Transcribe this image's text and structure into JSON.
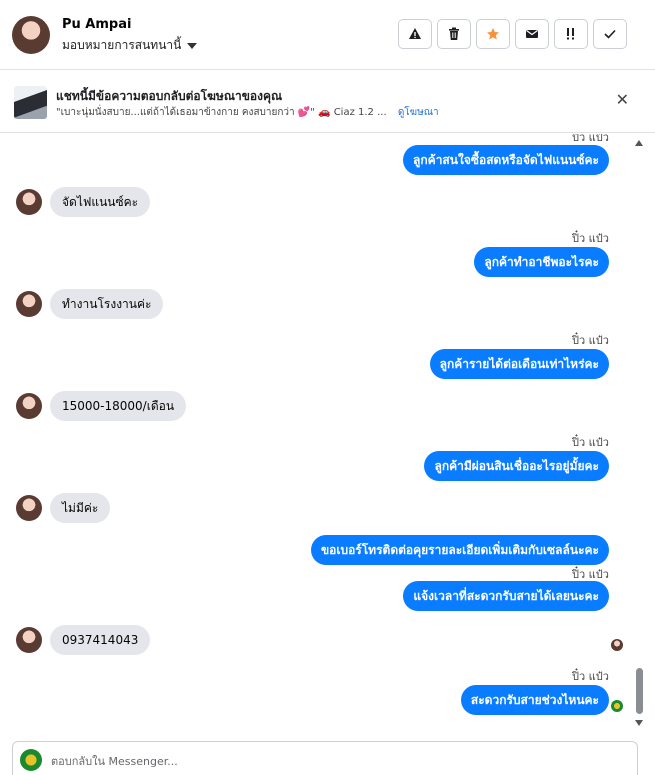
{
  "header": {
    "name": "Pu Ampai",
    "assign_label": "มอบหมายการสนทนานี้",
    "actions": [
      {
        "icon": "warning"
      },
      {
        "icon": "trash"
      },
      {
        "icon": "star",
        "color": "#f7923a"
      },
      {
        "icon": "mail"
      },
      {
        "icon": "mark-important"
      },
      {
        "icon": "check"
      }
    ]
  },
  "ad_banner": {
    "title": "แชทนี้มีข้อความตอบกลับต่อโฆษณาของคุณ",
    "snippet": "\"เบาะนุ่มนั่งสบาย...แต่ถ้าได้เธอมาข้างกาย คงสบายกว่า 💕\" 🚗 Ciaz 1.2 ...",
    "link": "ดูโฆษณา"
  },
  "messages": [
    {
      "dir": "out",
      "sender": "ปิ๋ว แป๋ว",
      "text": "ลูกค้าสนใจซื้อสดหรือจัดไฟแนนซ์คะ"
    },
    {
      "dir": "in",
      "text": "จัดไฟแนนซ์คะ"
    },
    {
      "dir": "out",
      "sender": "ปิ๋ว แป๋ว",
      "text": "ลูกค้าทำอาชีพอะไรคะ"
    },
    {
      "dir": "in",
      "text": "ทำงานโรงงานค่ะ"
    },
    {
      "dir": "out",
      "sender": "ปิ๋ว แป๋ว",
      "text": "ลูกค้ารายได้ต่อเดือนเท่าไหร่คะ"
    },
    {
      "dir": "in",
      "text": "15000-18000/เดือน"
    },
    {
      "dir": "out",
      "sender": "ปิ๋ว แป๋ว",
      "text": "ลูกค้ามีผ่อนสินเชื่ออะไรอยู่มั้ยคะ"
    },
    {
      "dir": "in",
      "text": "ไม่มีค่ะ"
    },
    {
      "dir": "out",
      "text": "ขอเบอร์โทรติดต่อคุยรายละเอียดเพิ่มเติมกับเซลล์นะคะ"
    },
    {
      "dir": "out",
      "sender": "ปิ๋ว แป๋ว",
      "text": "แจ้งเวลาที่สะดวกรับสายได้เลยนะคะ"
    },
    {
      "dir": "in",
      "text": "0937414043"
    },
    {
      "dir": "out",
      "sender": "ปิ๋ว แป๋ว",
      "text": "สะดวกรับสายช่วงไหนคะ"
    }
  ],
  "composer": {
    "placeholder": "ตอบกลับใน Messenger..."
  },
  "colors": {
    "outgoing_bubble": "#0a7cff",
    "incoming_bubble": "#e4e6eb",
    "link": "#216fdb"
  }
}
